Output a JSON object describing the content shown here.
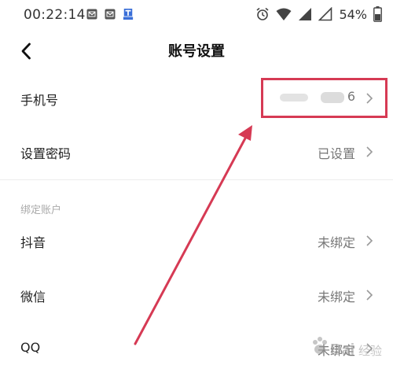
{
  "status_bar": {
    "time": "00:22:14",
    "battery": "54%",
    "notification_icons": [
      "mail-icon",
      "mail-icon",
      "app-notification-icon"
    ],
    "system_icons": [
      "alarm-icon",
      "wifi-icon",
      "signal-icon",
      "signal-icon"
    ]
  },
  "nav": {
    "title": "账号设置",
    "back_icon": "back-arrow-icon"
  },
  "rows": [
    {
      "label": "手机号",
      "value": "6"
    },
    {
      "label": "设置密码",
      "value": "已设置"
    },
    {
      "label": "抖音",
      "value": "未绑定"
    },
    {
      "label": "微信",
      "value": "未绑定"
    },
    {
      "label": "QQ",
      "value": "未绑定"
    }
  ],
  "section": {
    "bound_accounts": "绑定账户"
  },
  "annotation": {
    "color": "#d63a54"
  },
  "watermark": {
    "logo": "Baidu经验"
  }
}
